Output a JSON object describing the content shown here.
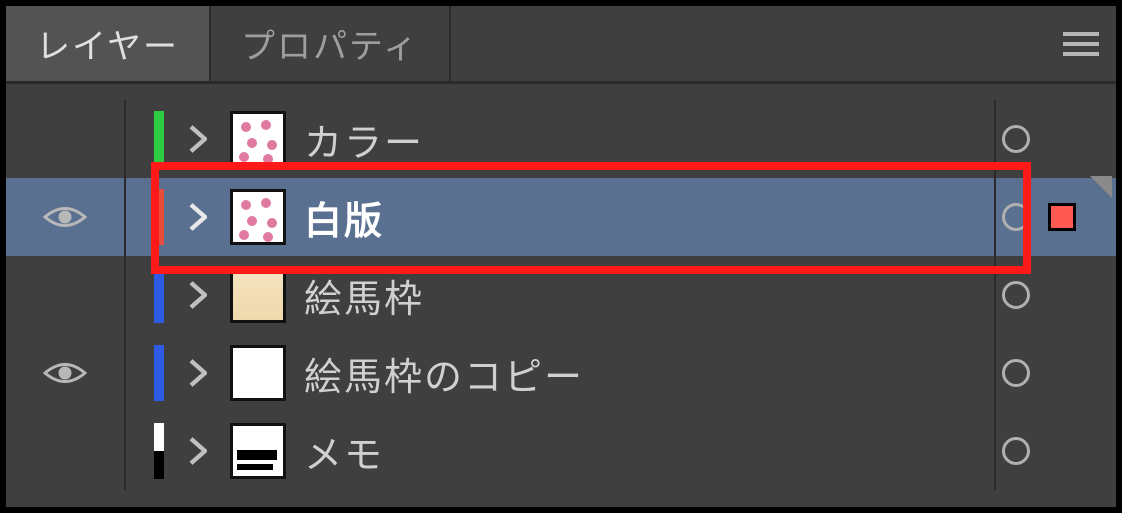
{
  "tabs": {
    "layers_label": "レイヤー",
    "properties_label": "プロパティ"
  },
  "layers": [
    {
      "name": "カラー",
      "colorbar": "green",
      "visible": false,
      "thumb": "flowers",
      "swatch": false,
      "selected": false
    },
    {
      "name": "白版",
      "colorbar": "red",
      "visible": true,
      "thumb": "flowers",
      "swatch": true,
      "selected": true
    },
    {
      "name": "絵馬枠",
      "colorbar": "blue",
      "visible": false,
      "thumb": "ema",
      "swatch": false,
      "selected": false
    },
    {
      "name": "絵馬枠のコピー",
      "colorbar": "blue",
      "visible": true,
      "thumb": "blank",
      "swatch": false,
      "selected": false
    },
    {
      "name": "メモ",
      "colorbar": "bw",
      "visible": false,
      "thumb": "memo",
      "swatch": false,
      "selected": false
    }
  ]
}
